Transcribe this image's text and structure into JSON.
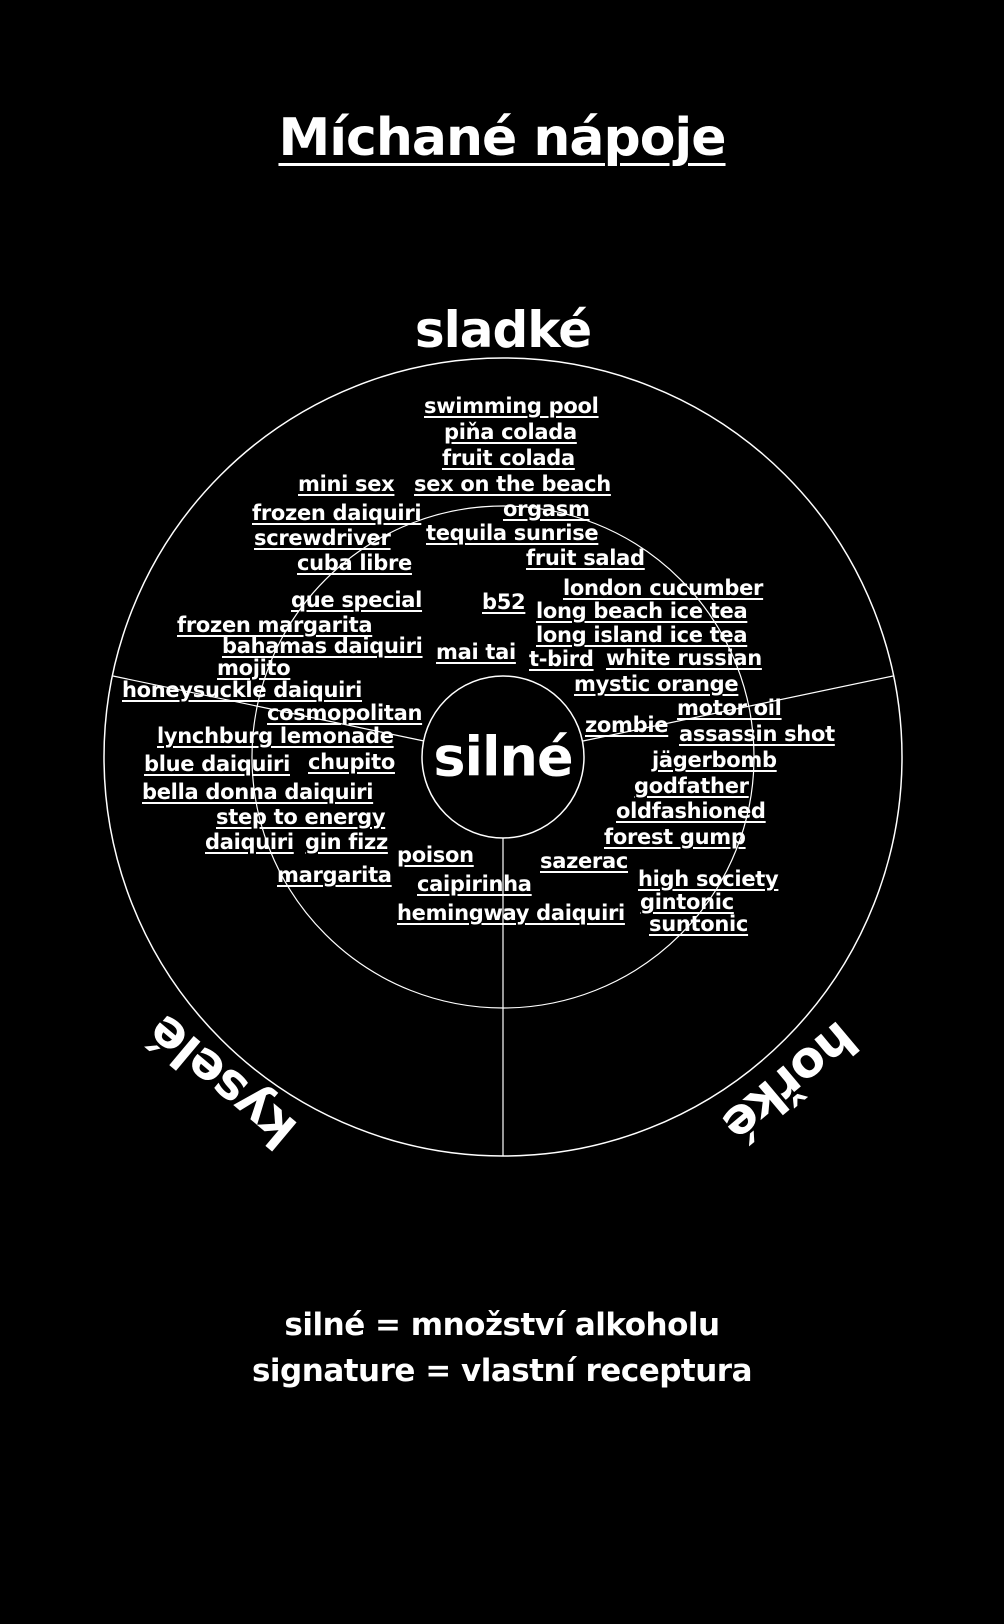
{
  "title": "Míchané nápoje",
  "axes": {
    "top": "sladké",
    "left": "kyselé",
    "right": "hořké",
    "center": "silné"
  },
  "drinks": [
    "swimming pool",
    "piňa colada",
    "fruit colada",
    "mini sex",
    "sex on the beach",
    "frozen daiquiri",
    "orgasm",
    "screwdriver",
    "tequila sunrise",
    "cuba libre",
    "fruit salad",
    "london cucumber",
    "que special",
    "b52",
    "long beach ice tea",
    "frozen margarita",
    "long island ice tea",
    "bahamas daiquiri",
    "mai tai",
    "t-bird",
    "white russian",
    "mojito",
    "mystic orange",
    "honeysuckle daiquiri",
    "motor oil",
    "cosmopolitan",
    "zombie",
    "lynchburg lemonade",
    "assassin shot",
    "blue daiquiri",
    "chupito",
    "jägerbomb",
    "bella donna daiquiri",
    "godfather",
    "step to energy",
    "oldfashioned",
    "daiquiri",
    "gin fizz",
    "forest gump",
    "poison",
    "sazerac",
    "margarita",
    "high society",
    "caipirinha",
    "gintonic",
    "hemingway daiquiri",
    "suntonic"
  ],
  "legend": {
    "line1": "silné = množství alkoholu",
    "line2": "signature = vlastní receptura"
  }
}
